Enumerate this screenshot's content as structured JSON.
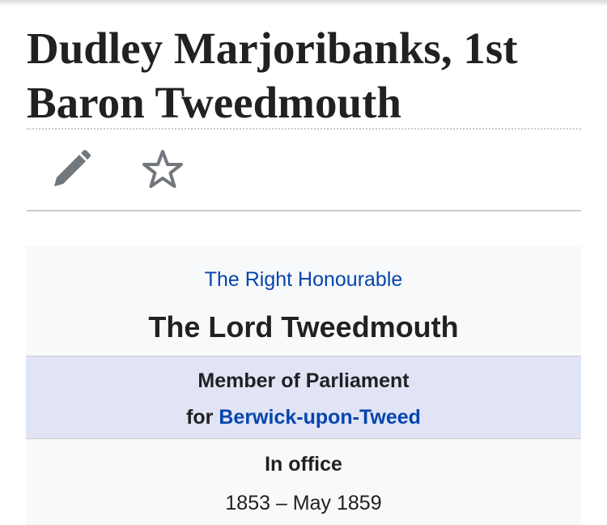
{
  "article": {
    "title": "Dudley Marjoribanks, 1st Baron Tweedmouth"
  },
  "actions": {
    "edit_icon": "pencil-icon",
    "watch_icon": "star-icon"
  },
  "infobox": {
    "honorific": "The Right Honourable",
    "name": "The Lord Tweedmouth",
    "office": {
      "title": "Member of Parliament",
      "for_prefix": "for",
      "constituency": "Berwick-upon-Tweed"
    },
    "in_office_label": "In office",
    "term": "1853 – May 1859"
  },
  "colors": {
    "link": "#0645ad",
    "text": "#202122",
    "infobox_bg": "#f8f9fa",
    "office_header_bg": "#e0e4f5",
    "icon": "#72777d"
  }
}
